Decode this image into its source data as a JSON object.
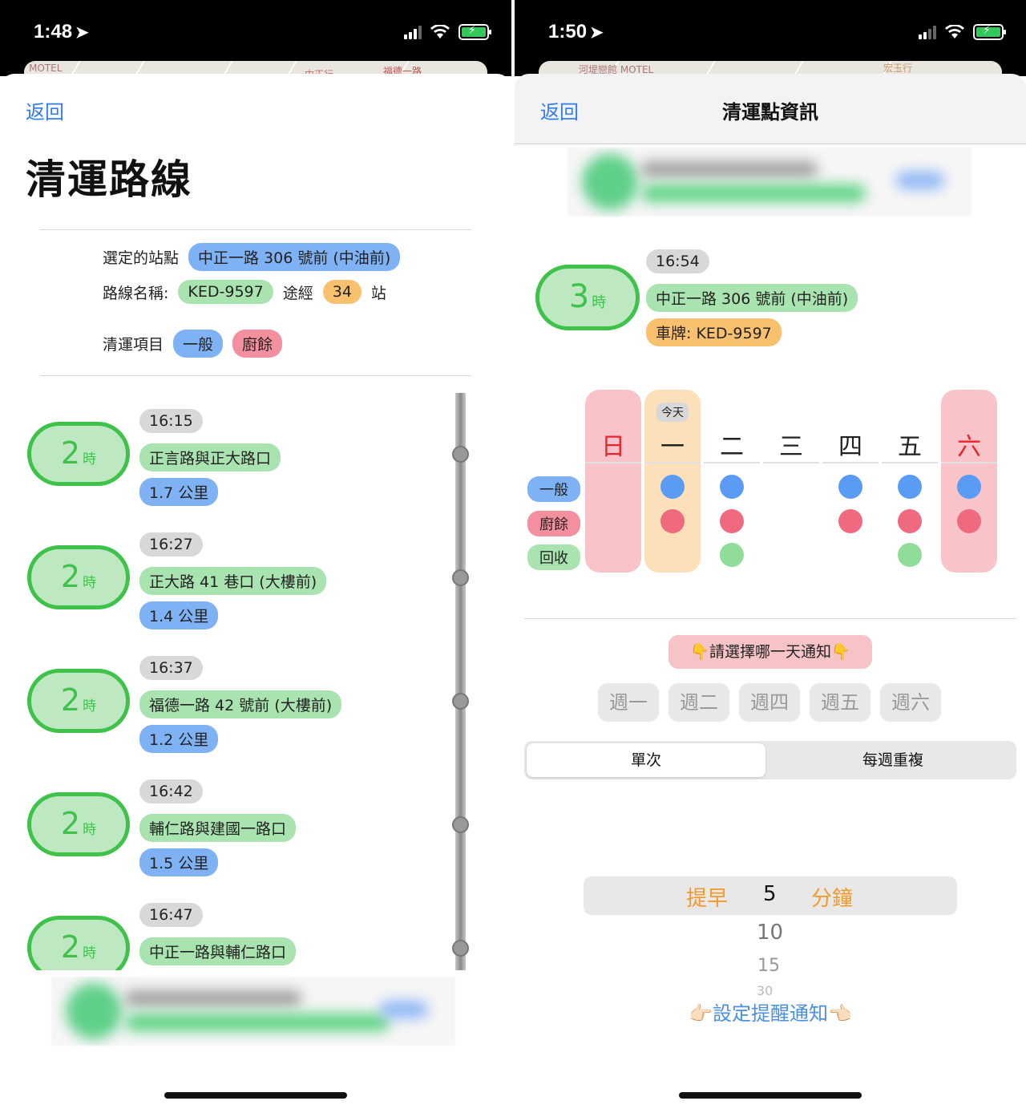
{
  "left": {
    "status": {
      "time": "1:48"
    },
    "map_labels": [
      "MOTEL",
      "中正行",
      "福德一路"
    ],
    "back": "返回",
    "title": "清運路線",
    "selected_label": "選定的站點",
    "selected_stop": "中正一路 306 號前 (中油前)",
    "route_label": "路線名稱:",
    "route_name": "KED-9597",
    "via_label": "途經",
    "stop_count": "34",
    "stop_unit": "站",
    "items_label": "清運項目",
    "item_general": "一般",
    "item_kitchen": "廚餘",
    "stops": [
      {
        "eta_num": "2",
        "eta_unit": "時",
        "time": "16:15",
        "name": "正言路與正大路口",
        "dist": "1.7 公里"
      },
      {
        "eta_num": "2",
        "eta_unit": "時",
        "time": "16:27",
        "name": "正大路 41 巷口 (大樓前)",
        "dist": "1.4 公里"
      },
      {
        "eta_num": "2",
        "eta_unit": "時",
        "time": "16:37",
        "name": "福德一路 42 號前 (大樓前)",
        "dist": "1.2 公里"
      },
      {
        "eta_num": "2",
        "eta_unit": "時",
        "time": "16:42",
        "name": "輔仁路與建國一路口",
        "dist": "1.5 公里"
      },
      {
        "eta_num": "2",
        "eta_unit": "時",
        "time": "16:47",
        "name": "中正一路與輔仁路口",
        "dist": ""
      }
    ]
  },
  "right": {
    "status": {
      "time": "1:50"
    },
    "map_labels": [
      "河堤戀館 MOTEL",
      "宏玉行"
    ],
    "back": "返回",
    "nav_title": "清運點資訊",
    "eta_num": "3",
    "eta_unit": "時",
    "time": "16:54",
    "stop_name": "中正一路 306 號前 (中油前)",
    "plate": "車牌: KED-9597",
    "today_badge": "今天",
    "days": [
      "日",
      "一",
      "二",
      "三",
      "四",
      "五",
      "六"
    ],
    "categories": [
      "一般",
      "廚餘",
      "回收"
    ],
    "schedule": {
      "一般": [
        false,
        true,
        true,
        false,
        true,
        true,
        true
      ],
      "廚餘": [
        false,
        true,
        true,
        false,
        true,
        true,
        true
      ],
      "回收": [
        false,
        false,
        true,
        false,
        false,
        true,
        false
      ]
    },
    "prompt": "👇請選擇哪一天通知👇",
    "weekday_buttons": [
      "週一",
      "週二",
      "週四",
      "週五",
      "週六"
    ],
    "segment": {
      "single": "單次",
      "weekly": "每週重複"
    },
    "picker": {
      "before": "提早",
      "selected": "5",
      "unit": "分鐘",
      "options": [
        "10",
        "15",
        "30"
      ]
    },
    "set_reminder": "👉🏻設定提醒通知👈🏻"
  },
  "colors": {
    "blue": "#7fb2f5",
    "green": "#a9e4b0",
    "orange": "#f9c16e",
    "pink": "#f48f9f",
    "eta_green": "#3ec24a",
    "sunday_sat_col": "#f8c4c9",
    "today_col": "#fbe0b9",
    "dot_general": "#5a9cf5",
    "dot_kitchen": "#f06a7f",
    "dot_recycle": "#8fdd98",
    "link": "#2f7cf6",
    "picker_accent": "#f39a2b"
  }
}
